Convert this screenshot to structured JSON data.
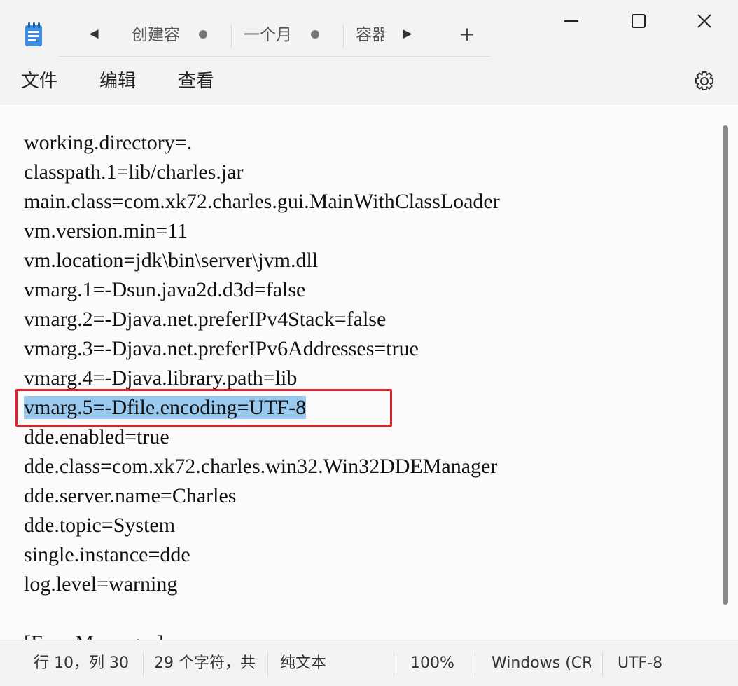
{
  "tabs": [
    {
      "label": "创建容",
      "modified": true
    },
    {
      "label": "一个月",
      "modified": true
    },
    {
      "label": "容器",
      "modified": false
    }
  ],
  "icons": {
    "app": "notepad-icon",
    "nav_left": "chevron-left-icon",
    "nav_right": "chevron-right-icon",
    "new_tab": "plus-icon",
    "minimize": "minimize-icon",
    "maximize": "maximize-icon",
    "close": "close-icon",
    "settings": "gear-icon"
  },
  "new_tab_label": "+",
  "menu": {
    "file": "文件",
    "edit": "编辑",
    "view": "查看"
  },
  "editor": {
    "lines": [
      "working.directory=.",
      "classpath.1=lib/charles.jar",
      "main.class=com.xk72.charles.gui.MainWithClassLoader",
      "vm.version.min=11",
      "vm.location=jdk\\bin\\server\\jvm.dll",
      "vmarg.1=-Dsun.java2d.d3d=false",
      "vmarg.2=-Djava.net.preferIPv4Stack=false",
      "vmarg.3=-Djava.net.preferIPv6Addresses=true",
      "vmarg.4=-Djava.library.path=lib",
      "vmarg.5=-Dfile.encoding=UTF-8",
      "dde.enabled=true",
      "dde.class=com.xk72.charles.win32.Win32DDEManager",
      "dde.server.name=Charles",
      "dde.topic=System",
      "single.instance=dde",
      "log.level=warning",
      "",
      "[ErrorMessages]"
    ],
    "selected_line_index": 9
  },
  "status": {
    "position": "行 10，列 30",
    "chars": "29 个字符，共",
    "format": "纯文本",
    "zoom": "100%",
    "line_ending": "Windows (CR",
    "encoding": "UTF-8"
  },
  "colors": {
    "selection": "#99c9ef",
    "highlight_box": "#e0232b",
    "app_icon": "#3a8ee6"
  }
}
